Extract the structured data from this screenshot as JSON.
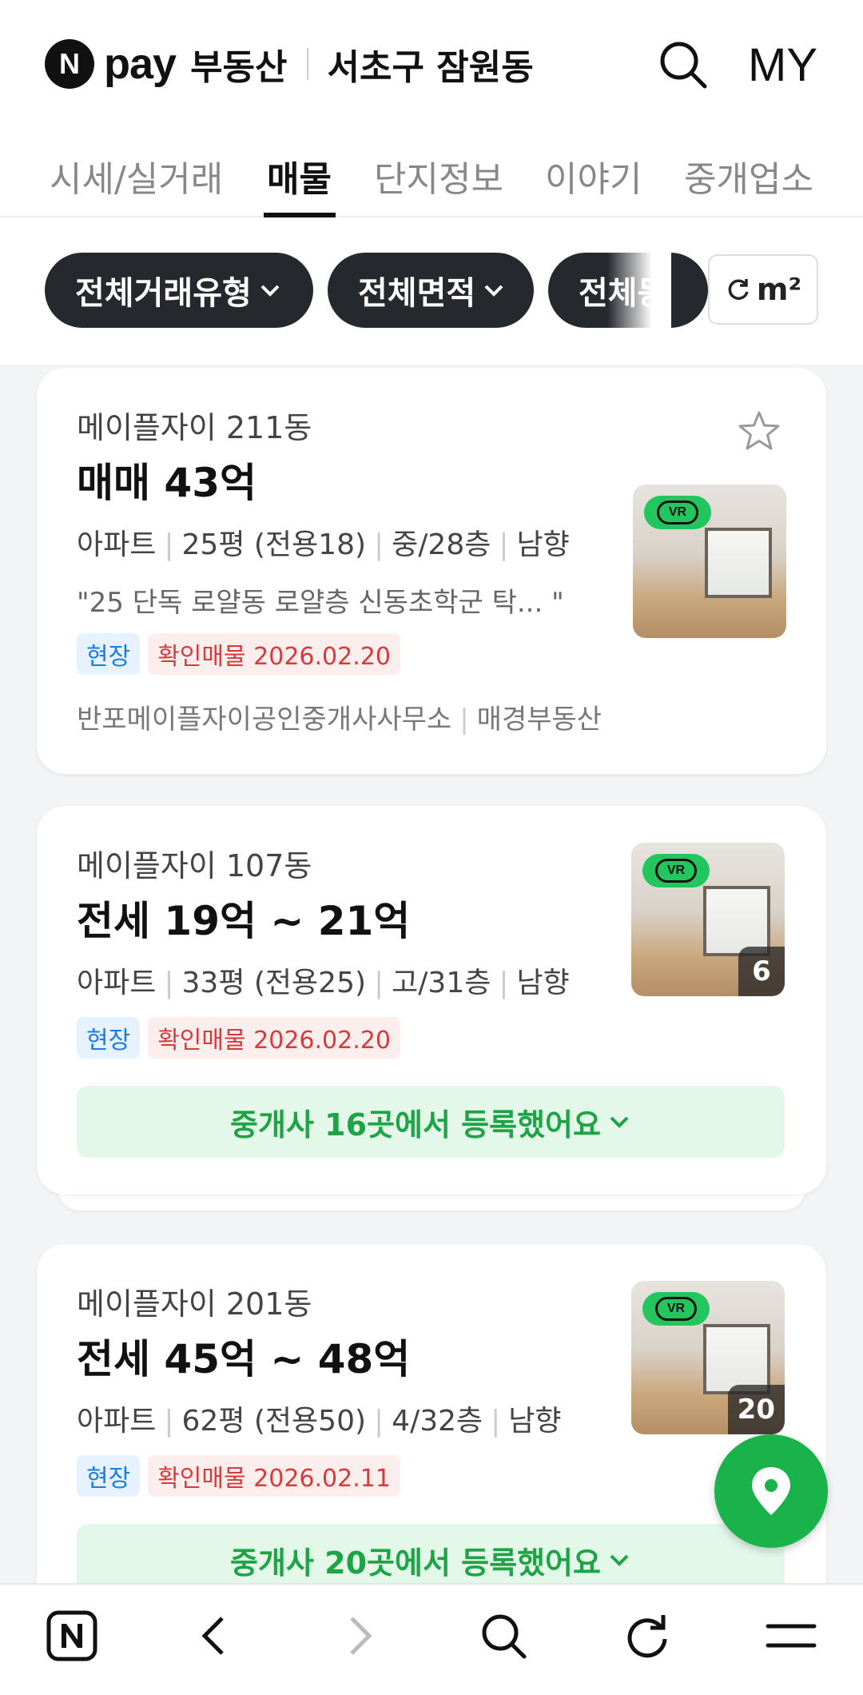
{
  "header": {
    "logo_letter": "N",
    "logo_pay": "pay",
    "service_name": "부동산",
    "location": "서초구 잠원동",
    "my_label": "MY"
  },
  "tabs": [
    {
      "label": "시세/실거래",
      "active": false
    },
    {
      "label": "매물",
      "active": true
    },
    {
      "label": "단지정보",
      "active": false
    },
    {
      "label": "이야기",
      "active": false
    },
    {
      "label": "중개업소",
      "active": false
    }
  ],
  "filters": {
    "chips": [
      "전체거래유형",
      "전체면적",
      "전체동"
    ],
    "unit_label": "m²"
  },
  "listings": [
    {
      "building": "메이플자이 211동",
      "price": "매매 43억",
      "meta": [
        "아파트",
        "25평 (전용18)",
        "중/28층",
        "남향"
      ],
      "description": "\"25 단독 로얄동 로얄층 신동초학군 탁... \"",
      "tag_site": "현장",
      "tag_confirmed": "확인매물 2026.02.20",
      "agencies": [
        "반포메이플자이공인중개사사무소",
        "매경부동산"
      ],
      "vr_label": "VR"
    },
    {
      "building": "메이플자이 107동",
      "price": "전세 19억 ~ 21억",
      "meta": [
        "아파트",
        "33평 (전용25)",
        "고/31층",
        "남향"
      ],
      "tag_site": "현장",
      "tag_confirmed": "확인매물 2026.02.20",
      "photo_count": "6",
      "agent_button": "중개사 16곳에서 등록했어요",
      "vr_label": "VR"
    },
    {
      "building": "메이플자이 201동",
      "price": "전세 45억 ~ 48억",
      "meta": [
        "아파트",
        "62평 (전용50)",
        "4/32층",
        "남향"
      ],
      "tag_site": "현장",
      "tag_confirmed": "확인매물 2026.02.11",
      "photo_count": "20",
      "agent_button": "중개사 20곳에서 등록했어요",
      "vr_label": "VR"
    }
  ],
  "colors": {
    "brand_green": "#19b24b",
    "chip_dark": "#25282d",
    "tag_blue": "#1a7ce0",
    "tag_red": "#d63a3a"
  },
  "icons": {
    "search": "search-icon",
    "refresh": "refresh-icon",
    "star": "star-icon",
    "map_pin": "map-pin-icon",
    "back": "chevron-left-icon",
    "forward": "chevron-right-icon",
    "reload": "reload-icon",
    "menu": "menu-icon"
  }
}
